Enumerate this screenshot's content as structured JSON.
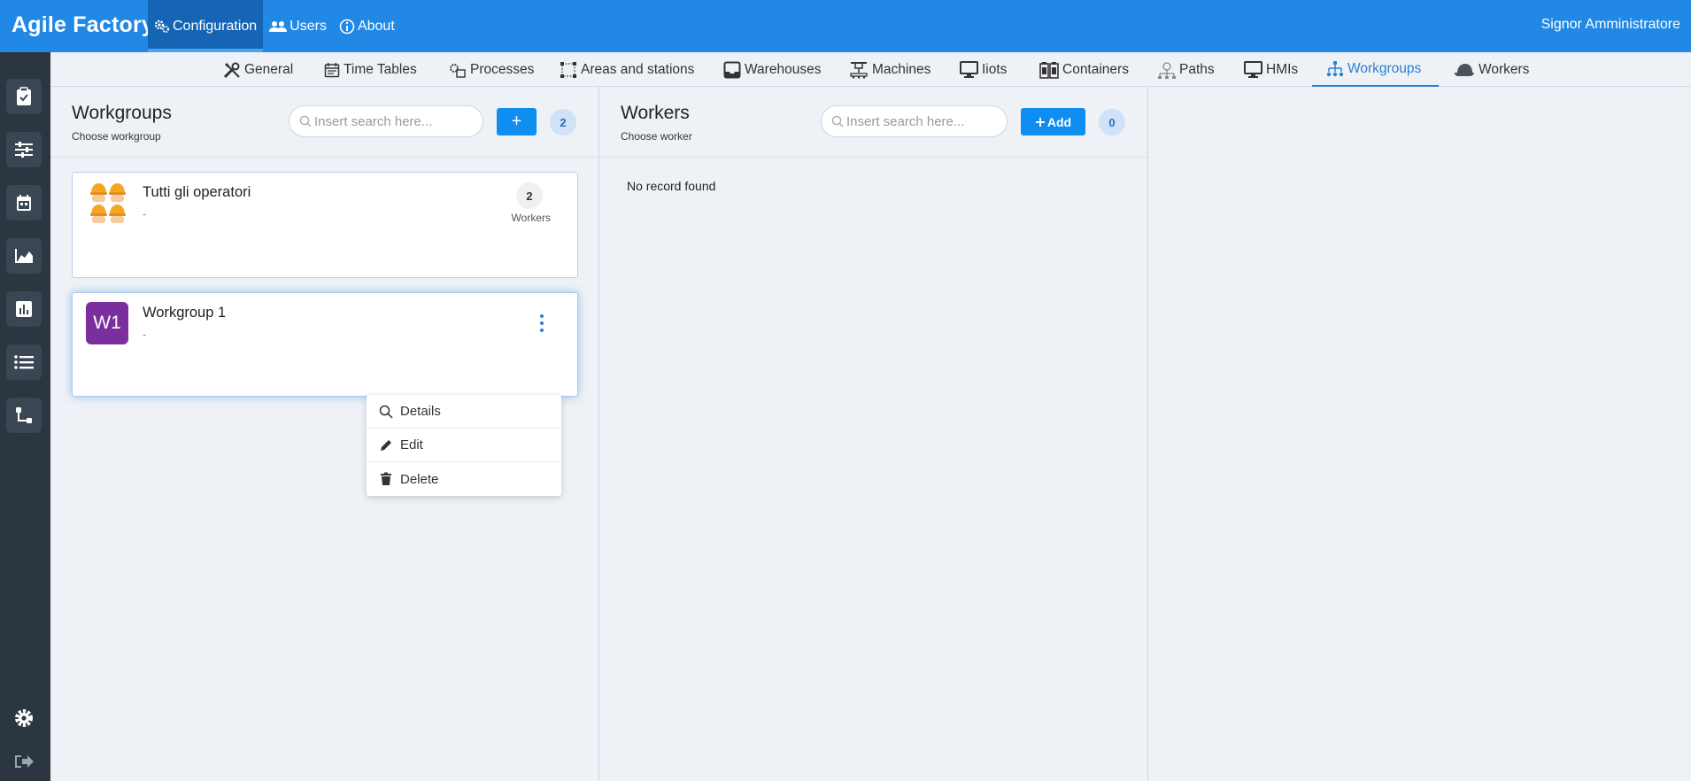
{
  "app": {
    "title": "Agile Factory"
  },
  "topnav": [
    {
      "label": "Configuration",
      "icon": "gears-icon"
    },
    {
      "label": "Users",
      "icon": "users-icon"
    },
    {
      "label": "About",
      "icon": "info-icon"
    }
  ],
  "user": {
    "name": "Signor Amministratore"
  },
  "subtabs": [
    {
      "label": "General",
      "icon": "tools-icon"
    },
    {
      "label": "Time Tables",
      "icon": "calendar-icon"
    },
    {
      "label": "Processes",
      "icon": "processes-icon"
    },
    {
      "label": "Areas and stations",
      "icon": "area-icon"
    },
    {
      "label": "Warehouses",
      "icon": "inbox-icon"
    },
    {
      "label": "Machines",
      "icon": "machine-icon"
    },
    {
      "label": "Iiots",
      "icon": "monitor-icon"
    },
    {
      "label": "Containers",
      "icon": "containers-icon"
    },
    {
      "label": "Paths",
      "icon": "paths-icon"
    },
    {
      "label": "HMIs",
      "icon": "monitor-icon"
    },
    {
      "label": "Workgroups",
      "icon": "workgroups-icon"
    },
    {
      "label": "Workers",
      "icon": "helmet-icon"
    }
  ],
  "workgroups": {
    "title": "Workgroups",
    "subtitle": "Choose workgroup",
    "search_placeholder": "Insert search here...",
    "add_label": "+",
    "count": "2",
    "items": [
      {
        "name": "Tutti gli operatori",
        "description": "-",
        "count": "2",
        "count_label": "Workers",
        "avatar": "operators-avatar-icon"
      },
      {
        "name": "Workgroup 1",
        "description": "-",
        "avatar_text": "W1"
      }
    ],
    "menu": [
      {
        "label": "Details",
        "icon": "search-icon"
      },
      {
        "label": "Edit",
        "icon": "pencil-icon"
      },
      {
        "label": "Delete",
        "icon": "trash-icon"
      }
    ]
  },
  "workers": {
    "title": "Workers",
    "subtitle": "Choose worker",
    "search_placeholder": "Insert search here...",
    "add_label": "Add",
    "count": "0",
    "empty_text": "No record found"
  },
  "colors": {
    "topbar": "#2188e5",
    "sidebar": "#2b3641",
    "accent": "#0d8ef0",
    "avatar": "#7b2f9e"
  }
}
